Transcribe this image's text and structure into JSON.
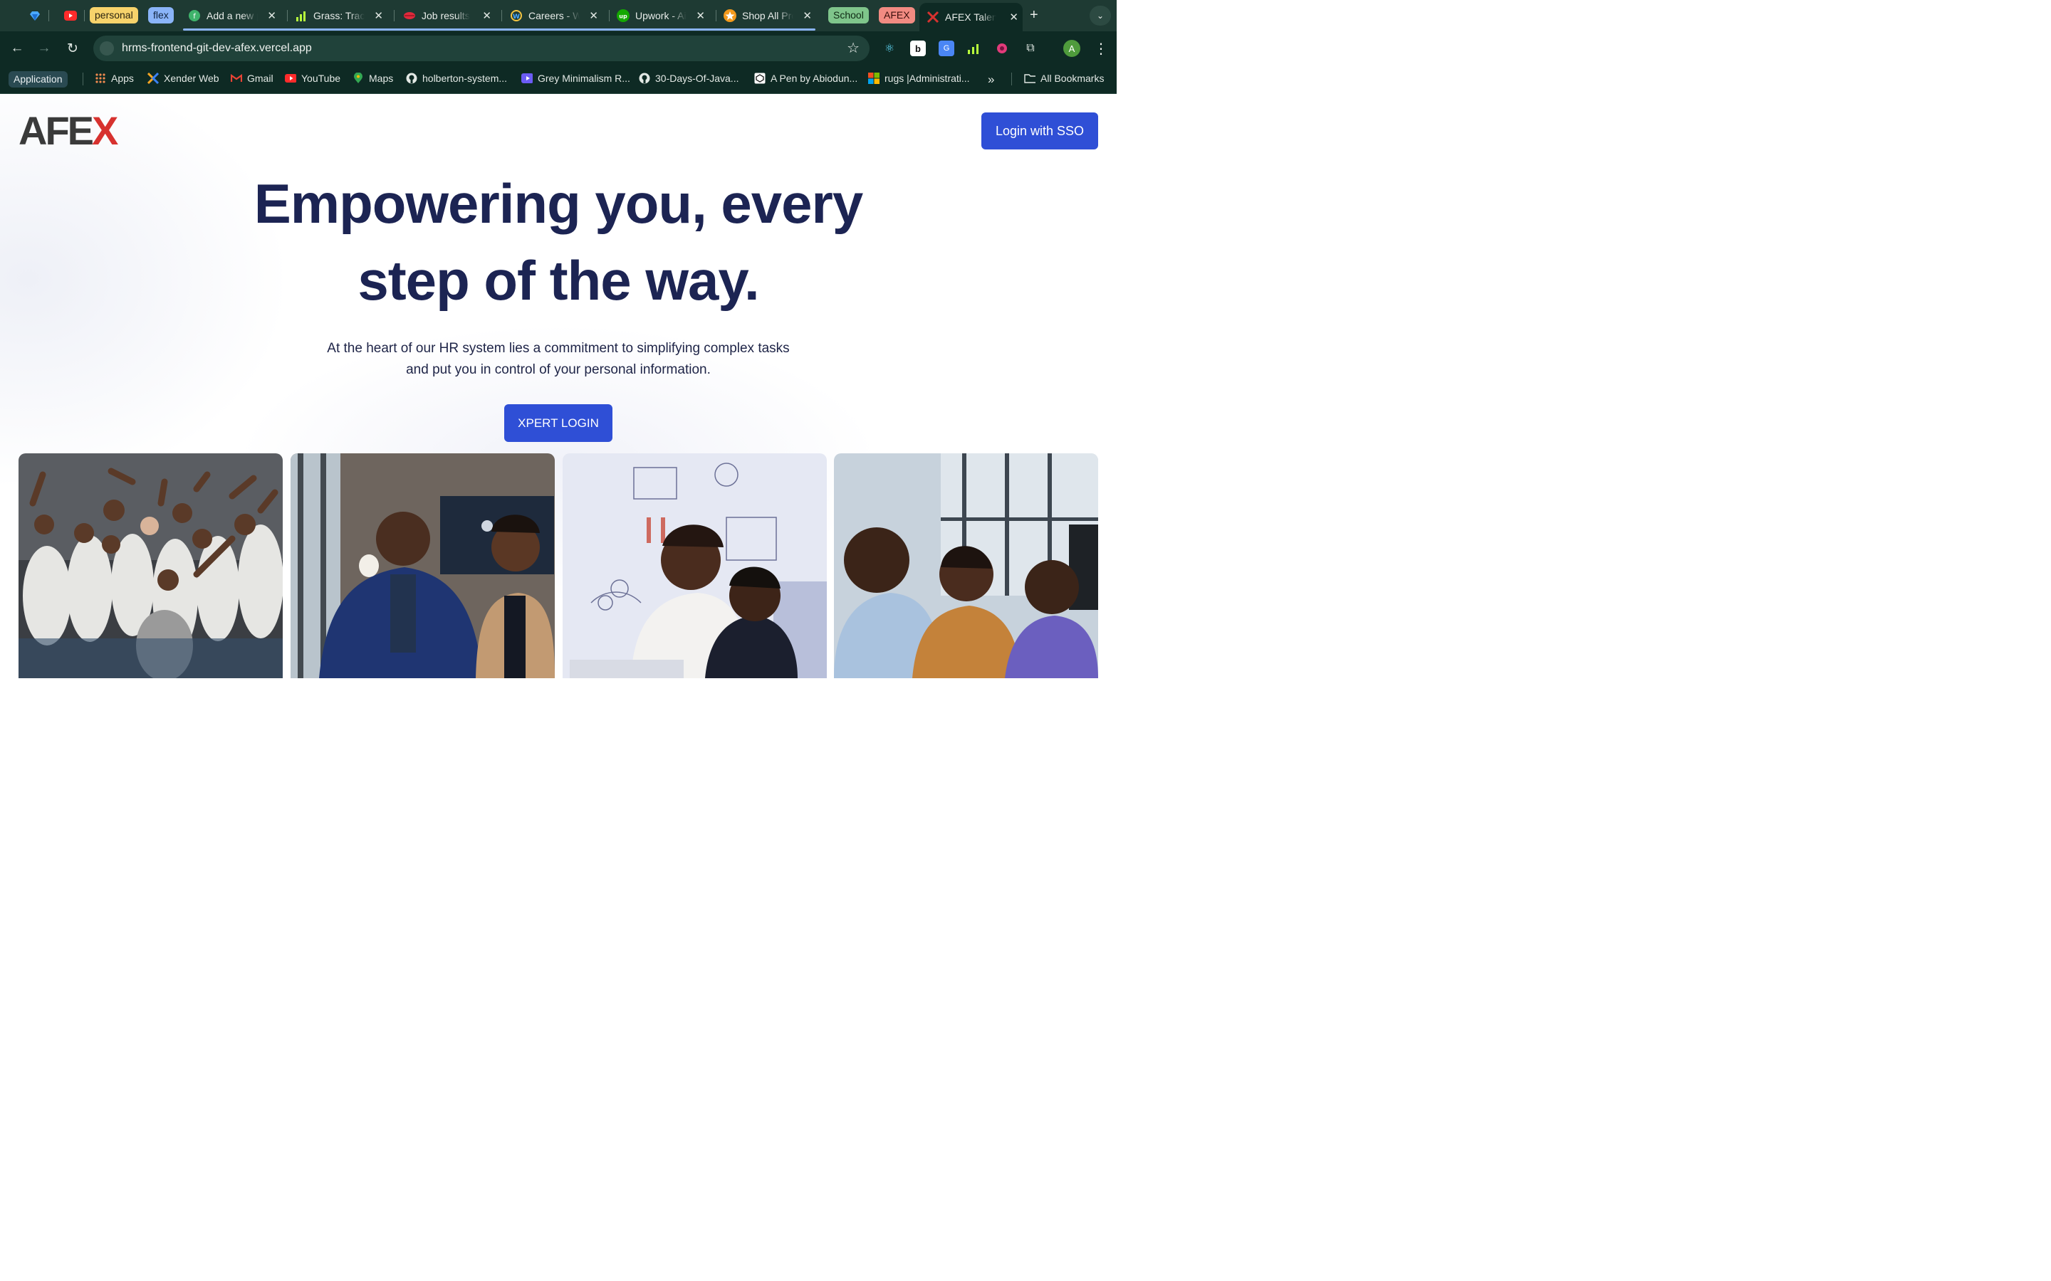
{
  "browser": {
    "tabs": [
      {
        "title": "Add a new p"
      },
      {
        "title": "Grass: Track"
      },
      {
        "title": "Job results"
      },
      {
        "title": "Careers - W"
      },
      {
        "title": "Upwork - Ai"
      },
      {
        "title": "Shop All Pro"
      },
      {
        "title": "AFEX Talent"
      }
    ],
    "groups": {
      "personal": "personal",
      "flex": "flex",
      "school": "School",
      "afex": "AFEX"
    },
    "url": "hrms-frontend-git-dev-afex.vercel.app",
    "profile_initial": "A",
    "bookmarks": {
      "folder_label": "Application",
      "items": [
        "Apps",
        "Xender Web",
        "Gmail",
        "YouTube",
        "Maps",
        "holberton-system...",
        "Grey Minimalism R...",
        "30-Days-Of-Java...",
        "A Pen by Abiodun...",
        "rugs |Administrati..."
      ],
      "overflow": "»",
      "all_bookmarks": "All Bookmarks"
    },
    "colors": {
      "chrome_bg": "#0e2a24",
      "tabstrip_bg": "#1e3a33"
    }
  },
  "page": {
    "logo": {
      "main": "AFE",
      "accent": "X"
    },
    "sso_button": "Login with SSO",
    "headline_line1": "Empowering you, every",
    "headline_line2": "step of the way.",
    "subtext_line1": "At the heart of our HR system lies a commitment to simplifying complex tasks",
    "subtext_line2": "and put you in control of your personal information.",
    "xpert_button": "XPERT LOGIN",
    "colors": {
      "primary": "#2f4fd6",
      "headline": "#1c2453",
      "logo_accent": "#d7322f"
    }
  }
}
